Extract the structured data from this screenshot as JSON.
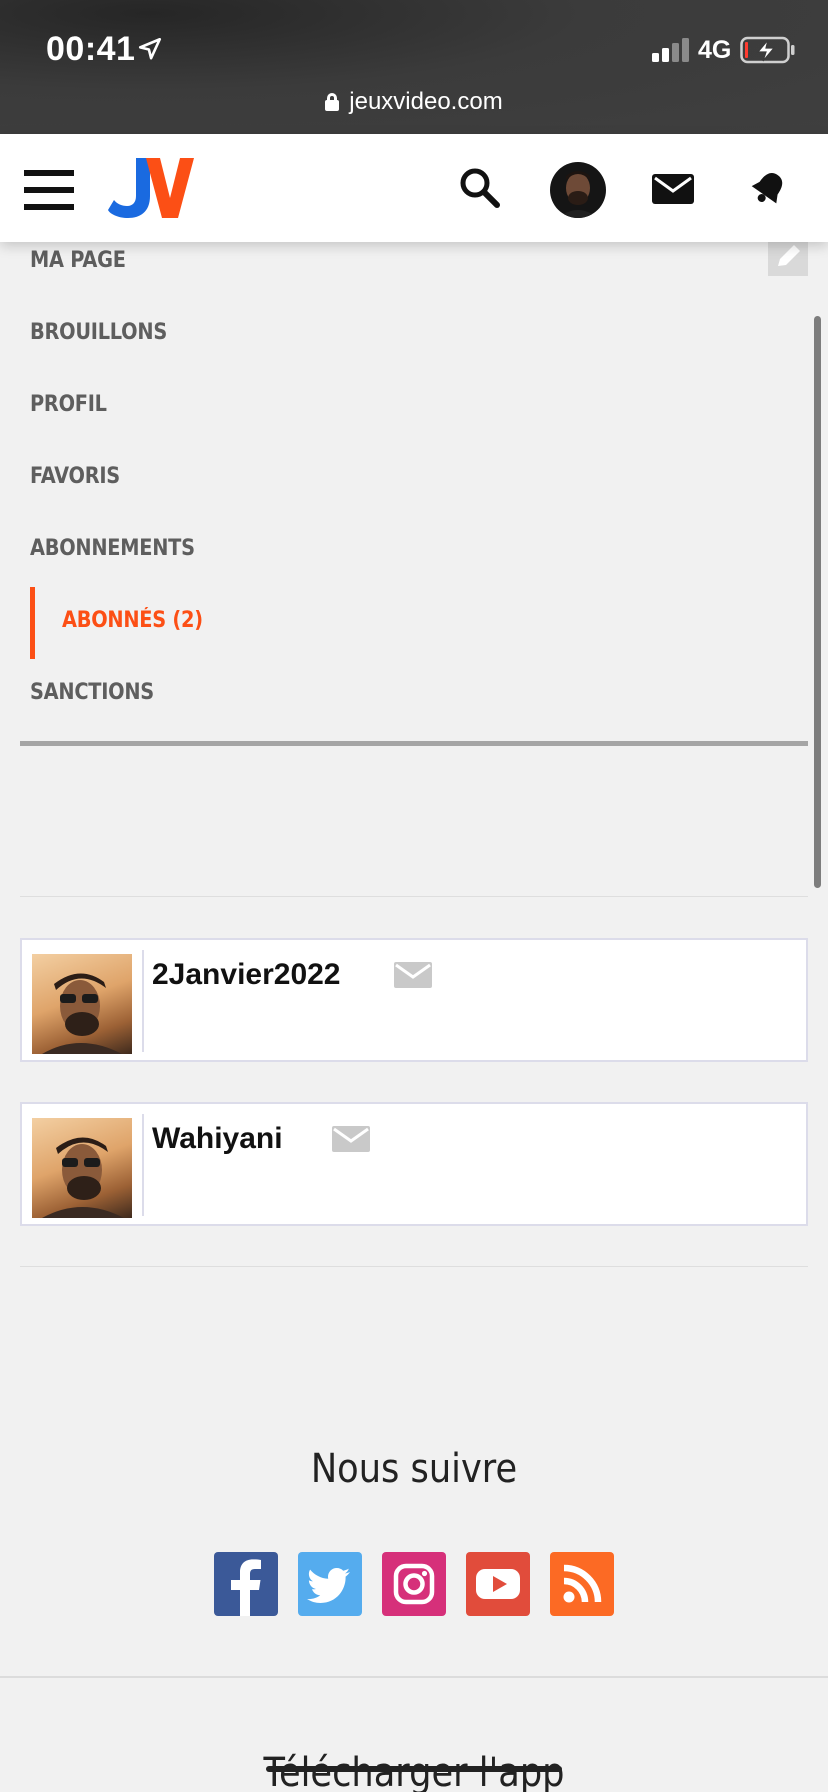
{
  "status_bar": {
    "time": "00:41",
    "network": "4G",
    "url": "jeuxvideo.com",
    "icons": [
      "location-arrow-icon",
      "signal-icon",
      "battery-charging-icon",
      "lock-icon"
    ]
  },
  "header": {
    "icons": [
      "menu-icon",
      "jv-logo",
      "search-icon",
      "user-avatar",
      "mail-icon",
      "bell-icon"
    ],
    "logo_colors": {
      "j": "#1a6ae0",
      "v": "#fc4f15"
    }
  },
  "menu": {
    "items": [
      {
        "label": "MA PAGE"
      },
      {
        "label": "BROUILLONS"
      },
      {
        "label": "PROFIL"
      },
      {
        "label": "FAVORIS"
      },
      {
        "label": "ABONNEMENTS"
      },
      {
        "label": "ABONNÉS (2)",
        "active": true
      },
      {
        "label": "SANCTIONS"
      }
    ],
    "accent_color": "#fc4f15"
  },
  "followers": [
    {
      "username": "2Janvier2022"
    },
    {
      "username": "Wahiyani"
    }
  ],
  "footer": {
    "follow_title": "Nous suivre",
    "social": [
      "facebook-icon",
      "twitter-icon",
      "instagram-icon",
      "youtube-icon",
      "rss-icon"
    ],
    "download_app": "Télécharger l'app"
  }
}
